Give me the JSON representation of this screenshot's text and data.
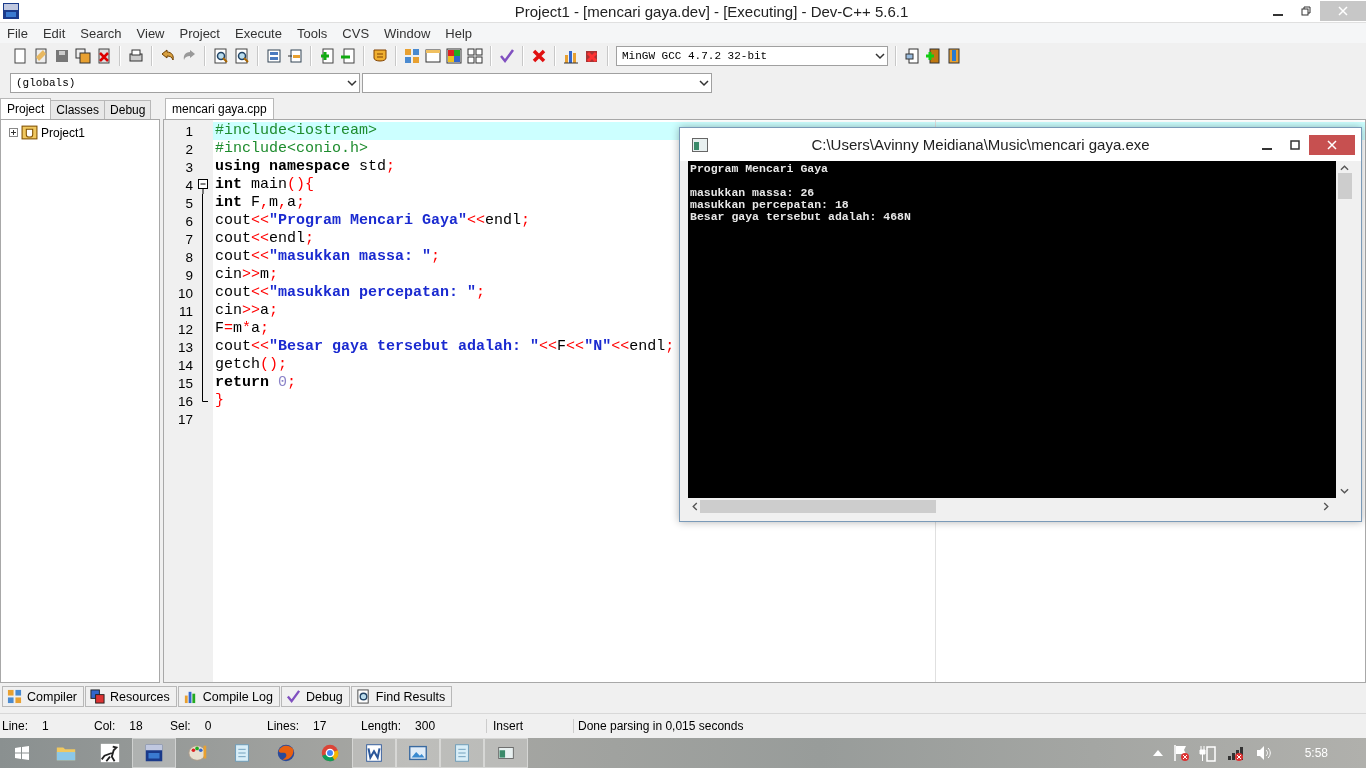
{
  "window": {
    "title": "Project1 - [mencari gaya.dev] - [Executing] - Dev-C++ 5.6.1"
  },
  "menu": [
    "File",
    "Edit",
    "Search",
    "View",
    "Project",
    "Execute",
    "Tools",
    "CVS",
    "Window",
    "Help"
  ],
  "toolbar": {
    "compiler_select": "MinGW GCC 4.7.2 32-bit"
  },
  "scope_bar": {
    "class_select": "(globals)"
  },
  "left_panel": {
    "tabs": [
      {
        "label": "Project",
        "selected": true
      },
      {
        "label": "Classes",
        "selected": false
      },
      {
        "label": "Debug",
        "selected": false
      }
    ],
    "tree": [
      {
        "label": "Project1",
        "expanded": false
      }
    ]
  },
  "editor": {
    "tabs": [
      {
        "label": "mencari gaya.cpp",
        "selected": true
      }
    ],
    "lines": [
      {
        "number": "1",
        "current": true,
        "tokens": [
          {
            "kind": "pp",
            "text": "#include<iostream>"
          }
        ]
      },
      {
        "number": "2",
        "current": false,
        "tokens": [
          {
            "kind": "pp",
            "text": "#include<conio.h>"
          }
        ]
      },
      {
        "number": "3",
        "current": false,
        "tokens": [
          {
            "kind": "kw",
            "text": "using namespace"
          },
          {
            "kind": "plain",
            "text": " std"
          },
          {
            "kind": "sym",
            "text": ";"
          }
        ]
      },
      {
        "number": "4",
        "current": false,
        "kind": "fold_start",
        "tokens": [
          {
            "kind": "kw",
            "text": "int"
          },
          {
            "kind": "plain",
            "text": " main"
          },
          {
            "kind": "sym",
            "text": "(){"
          }
        ]
      },
      {
        "number": "5",
        "current": false,
        "kind": "fold_body",
        "tokens": [
          {
            "kind": "kw",
            "text": "int"
          },
          {
            "kind": "plain",
            "text": " F"
          },
          {
            "kind": "sym",
            "text": ","
          },
          {
            "kind": "plain",
            "text": "m"
          },
          {
            "kind": "sym",
            "text": ","
          },
          {
            "kind": "plain",
            "text": "a"
          },
          {
            "kind": "sym",
            "text": ";"
          }
        ]
      },
      {
        "number": "6",
        "current": false,
        "kind": "fold_body",
        "tokens": [
          {
            "kind": "plain",
            "text": "cout"
          },
          {
            "kind": "sym",
            "text": "<<"
          },
          {
            "kind": "str",
            "text": "\"Program Mencari Gaya\""
          },
          {
            "kind": "sym",
            "text": "<<"
          },
          {
            "kind": "plain",
            "text": "endl"
          },
          {
            "kind": "sym",
            "text": ";"
          }
        ]
      },
      {
        "number": "7",
        "current": false,
        "kind": "fold_body",
        "tokens": [
          {
            "kind": "plain",
            "text": "cout"
          },
          {
            "kind": "sym",
            "text": "<<"
          },
          {
            "kind": "plain",
            "text": "endl"
          },
          {
            "kind": "sym",
            "text": ";"
          }
        ]
      },
      {
        "number": "8",
        "current": false,
        "kind": "fold_body",
        "tokens": [
          {
            "kind": "plain",
            "text": "cout"
          },
          {
            "kind": "sym",
            "text": "<<"
          },
          {
            "kind": "str",
            "text": "\"masukkan massa: \""
          },
          {
            "kind": "sym",
            "text": ";"
          }
        ]
      },
      {
        "number": "9",
        "current": false,
        "kind": "fold_body",
        "tokens": [
          {
            "kind": "plain",
            "text": "cin"
          },
          {
            "kind": "sym",
            "text": ">>"
          },
          {
            "kind": "plain",
            "text": "m"
          },
          {
            "kind": "sym",
            "text": ";"
          }
        ]
      },
      {
        "number": "10",
        "current": false,
        "kind": "fold_body",
        "tokens": [
          {
            "kind": "plain",
            "text": "cout"
          },
          {
            "kind": "sym",
            "text": "<<"
          },
          {
            "kind": "str",
            "text": "\"masukkan percepatan: \""
          },
          {
            "kind": "sym",
            "text": ";"
          }
        ]
      },
      {
        "number": "11",
        "current": false,
        "kind": "fold_body",
        "tokens": [
          {
            "kind": "plain",
            "text": "cin"
          },
          {
            "kind": "sym",
            "text": ">>"
          },
          {
            "kind": "plain",
            "text": "a"
          },
          {
            "kind": "sym",
            "text": ";"
          }
        ]
      },
      {
        "number": "12",
        "current": false,
        "kind": "fold_body",
        "tokens": [
          {
            "kind": "plain",
            "text": "F"
          },
          {
            "kind": "sym",
            "text": "="
          },
          {
            "kind": "plain",
            "text": "m"
          },
          {
            "kind": "sym",
            "text": "*"
          },
          {
            "kind": "plain",
            "text": "a"
          },
          {
            "kind": "sym",
            "text": ";"
          }
        ]
      },
      {
        "number": "13",
        "current": false,
        "kind": "fold_body",
        "tokens": [
          {
            "kind": "plain",
            "text": "cout"
          },
          {
            "kind": "sym",
            "text": "<<"
          },
          {
            "kind": "str",
            "text": "\"Besar gaya tersebut adalah: \""
          },
          {
            "kind": "sym",
            "text": "<<"
          },
          {
            "kind": "plain",
            "text": "F"
          },
          {
            "kind": "sym",
            "text": "<<"
          },
          {
            "kind": "str",
            "text": "\"N\""
          },
          {
            "kind": "sym",
            "text": "<<"
          },
          {
            "kind": "plain",
            "text": "endl"
          },
          {
            "kind": "sym",
            "text": ";"
          }
        ]
      },
      {
        "number": "14",
        "current": false,
        "kind": "fold_body",
        "tokens": [
          {
            "kind": "plain",
            "text": "getch"
          },
          {
            "kind": "sym",
            "text": "();"
          }
        ]
      },
      {
        "number": "15",
        "current": false,
        "kind": "fold_body",
        "tokens": [
          {
            "kind": "kw",
            "text": "return "
          },
          {
            "kind": "num",
            "text": "0"
          },
          {
            "kind": "sym",
            "text": ";"
          }
        ]
      },
      {
        "number": "16",
        "current": false,
        "kind": "fold_end",
        "tokens": [
          {
            "kind": "sym",
            "text": "}"
          }
        ]
      },
      {
        "number": "17",
        "current": false
      }
    ]
  },
  "console": {
    "title": "C:\\Users\\Avinny Meidiana\\Music\\mencari gaya.exe",
    "blocks": [
      {
        "lines": [
          "Program Mencari Gaya"
        ]
      },
      {
        "lines": [
          "masukkan massa: 26",
          "masukkan percepatan: 18",
          "Besar gaya tersebut adalah: 468N"
        ]
      }
    ]
  },
  "bottom_tabs": [
    {
      "label": "Compiler",
      "kind": "compiler"
    },
    {
      "label": "Resources",
      "kind": "resources"
    },
    {
      "label": "Compile Log",
      "kind": "log"
    },
    {
      "label": "Debug",
      "kind": "debug"
    },
    {
      "label": "Find Results",
      "kind": "find"
    }
  ],
  "status_bar": {
    "fields": [
      {
        "label": "Line:",
        "value": "1"
      },
      {
        "label": "Col:",
        "value": "18"
      },
      {
        "label": "Sel:",
        "value": "0"
      },
      {
        "label": "Lines:",
        "value": "17"
      },
      {
        "label": "Length:",
        "value": "300"
      }
    ],
    "mode": "Insert",
    "message": "Done parsing in 0,015 seconds"
  },
  "taskbar": {
    "apps": [
      {
        "kind": "explorer",
        "active": false
      },
      {
        "kind": "dino",
        "active": false
      },
      {
        "kind": "devcpp",
        "active": true
      },
      {
        "kind": "paint",
        "active": false
      },
      {
        "kind": "notepad",
        "active": false
      },
      {
        "kind": "firefox",
        "active": false
      },
      {
        "kind": "chrome",
        "active": false
      },
      {
        "kind": "word",
        "active": true
      },
      {
        "kind": "photos",
        "active": true
      },
      {
        "kind": "notepad",
        "active": true
      },
      {
        "kind": "console",
        "active": true
      }
    ],
    "clock": "5:58"
  }
}
